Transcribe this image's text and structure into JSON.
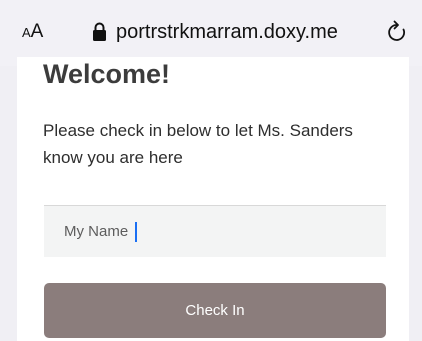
{
  "browser": {
    "text_size_label": "AA",
    "url": "portrstrkmarram.doxy.me"
  },
  "checkin": {
    "title": "Welcome!",
    "instructions": "Please check in below to let Ms. Sanders know you are here",
    "name_placeholder": "My Name",
    "button_label": "Check In"
  },
  "colors": {
    "button_background": "#8b7d7c",
    "caret": "#1a6ff3"
  }
}
